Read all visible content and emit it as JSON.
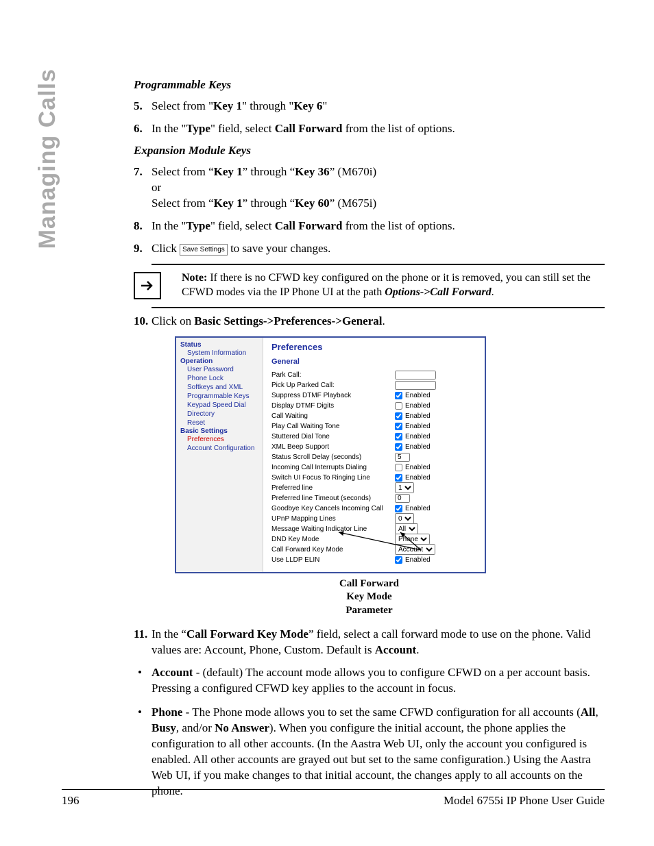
{
  "sideTab": "Managing Calls",
  "sections": {
    "programmableKeys": "Programmable Keys",
    "expansionModuleKeys": "Expansion Module Keys"
  },
  "steps": {
    "s5": {
      "pre": "Select from \"",
      "k1": "Key 1",
      "mid": "\" through \"",
      "k2": "Key 6",
      "post": "\""
    },
    "s6": {
      "pre": "In the \"",
      "type": "Type",
      "mid": "\" field, select ",
      "cf": "Call Forward",
      "post": " from the list of options."
    },
    "s7": {
      "pre1": "Select from “",
      "k1": "Key 1",
      "mid1": "” through “",
      "k2": "Key 36",
      "post1": "” (M670i)",
      "or": "or",
      "pre2": "Select from “",
      "k3": "Key 1",
      "mid2": "” through “",
      "k4": "Key 60",
      "post2": "” (M675i)"
    },
    "s8": {
      "pre": "In the \"",
      "type": "Type",
      "mid": "\" field, select ",
      "cf": "Call Forward",
      "post": " from the list of options."
    },
    "s9": {
      "pre": "Click ",
      "btn": "Save Settings",
      "post": " to save your changes."
    },
    "s10": {
      "pre": "Click on ",
      "path": "Basic Settings->Preferences->General",
      "post": "."
    },
    "s11": {
      "pre": "In the “",
      "field": "Call Forward Key Mode",
      "mid": "” field, select a call forward mode to use on the phone. Valid values are: Account, Phone, Custom. Default is ",
      "def": "Account",
      "post": "."
    }
  },
  "note": {
    "lead": "Note:",
    "body1": " If there is no CFWD key configured on the phone or it is removed, you can still set the CFWD modes via the IP Phone UI at the path ",
    "path": "Options->Call Forward",
    "post": "."
  },
  "bullets": {
    "account": {
      "lead": "Account",
      "rest": " - (default) The account mode allows you to configure CFWD on a per account basis. Pressing a configured CFWD key applies to the account in focus."
    },
    "phone": {
      "lead": "Phone",
      "rest1": " - The Phone mode allows you to set the same CFWD configuration for all accounts (",
      "all": "All",
      "c1": ", ",
      "busy": "Busy",
      "c2": ", and/or ",
      "noans": "No Answer",
      "rest2": "). When you configure the initial account, the phone applies the configuration to all other accounts. (In the Aastra Web UI, only the account you configured is enabled. All other accounts are grayed out but set to the same configuration.) Using the Aastra Web UI, if you make changes to that initial account, the changes apply to all accounts on the phone."
    }
  },
  "screenshot": {
    "side": {
      "status": "Status",
      "sysinfo": "System Information",
      "operation": "Operation",
      "items": [
        "User Password",
        "Phone Lock",
        "Softkeys and XML",
        "Programmable Keys",
        "Keypad Speed Dial",
        "Directory",
        "Reset"
      ],
      "basic": "Basic Settings",
      "prefs": "Preferences",
      "acct": "Account Configuration"
    },
    "panelTitle": "Preferences",
    "groupTitle": "General",
    "rows": [
      {
        "label": "Park Call:",
        "ctrl": "text",
        "value": ""
      },
      {
        "label": "Pick Up Parked Call:",
        "ctrl": "text",
        "value": ""
      },
      {
        "label": "Suppress DTMF Playback",
        "ctrl": "cb",
        "checked": true,
        "cblabel": "Enabled"
      },
      {
        "label": "Display DTMF Digits",
        "ctrl": "cb",
        "checked": false,
        "cblabel": "Enabled"
      },
      {
        "label": "Call Waiting",
        "ctrl": "cb",
        "checked": true,
        "cblabel": "Enabled"
      },
      {
        "label": "Play Call Waiting Tone",
        "ctrl": "cb",
        "checked": true,
        "cblabel": "Enabled"
      },
      {
        "label": "Stuttered Dial Tone",
        "ctrl": "cb",
        "checked": true,
        "cblabel": "Enabled"
      },
      {
        "label": "XML Beep Support",
        "ctrl": "cb",
        "checked": true,
        "cblabel": "Enabled"
      },
      {
        "label": "Status Scroll Delay (seconds)",
        "ctrl": "tiny",
        "value": "5"
      },
      {
        "label": "Incoming Call Interrupts Dialing",
        "ctrl": "cb",
        "checked": false,
        "cblabel": "Enabled"
      },
      {
        "label": "Switch UI Focus To Ringing Line",
        "ctrl": "cb",
        "checked": true,
        "cblabel": "Enabled"
      },
      {
        "label": "Preferred line",
        "ctrl": "select",
        "value": "1"
      },
      {
        "label": "Preferred line Timeout (seconds)",
        "ctrl": "tiny",
        "value": "0"
      },
      {
        "label": "Goodbye Key Cancels Incoming Call",
        "ctrl": "cb",
        "checked": true,
        "cblabel": "Enabled"
      },
      {
        "label": "UPnP Mapping Lines",
        "ctrl": "select",
        "value": "0"
      },
      {
        "label": "Message Waiting Indicator Line",
        "ctrl": "select",
        "value": "All"
      },
      {
        "label": "DND Key Mode",
        "ctrl": "select",
        "value": "Phone"
      },
      {
        "label": "Call Forward Key Mode",
        "ctrl": "select",
        "value": "Account"
      },
      {
        "label": "Use LLDP ELIN",
        "ctrl": "cb",
        "checked": true,
        "cblabel": "Enabled"
      }
    ]
  },
  "callout": {
    "l1": "Call Forward",
    "l2": "Key Mode",
    "l3": "Parameter"
  },
  "footer": {
    "page": "196",
    "title": "Model 6755i IP Phone User Guide"
  }
}
